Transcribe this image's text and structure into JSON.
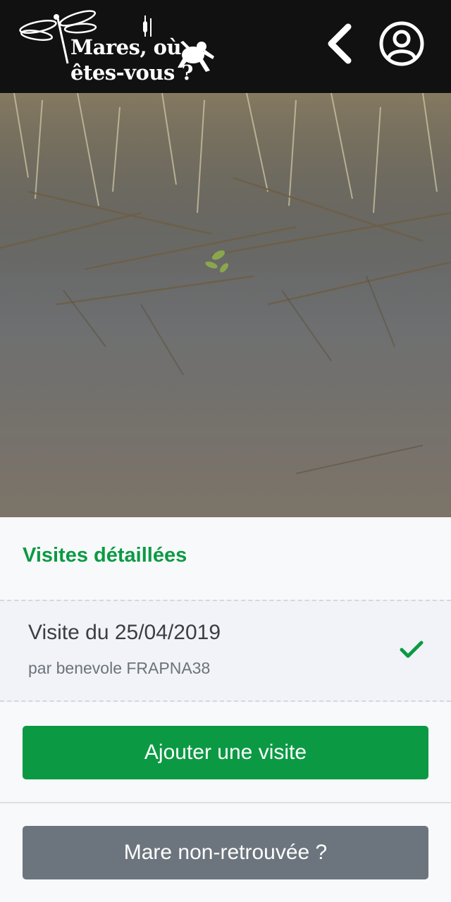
{
  "header": {
    "logo_line1": "Mares, où",
    "logo_line2": "êtes-vous ?",
    "logo_icons": [
      "dragonfly-icon",
      "cattail-icon",
      "frog-icon"
    ],
    "back_icon": "chevron-left-icon",
    "account_icon": "user-circle-icon",
    "background_color": "#111111"
  },
  "photo": {
    "subject": "pond-water-vegetation-photo"
  },
  "visits": {
    "title": "Visites détaillées",
    "accent_color": "#0b9a43",
    "items": [
      {
        "title": "Visite du 25/04/2019",
        "author": "par benevole FRAPNA38",
        "status_icon": "check-icon"
      }
    ]
  },
  "actions": {
    "add_visit_label": "Ajouter une visite",
    "add_visit_color": "#0b9a43",
    "not_found_label": "Mare non-retrouvée ?",
    "not_found_color": "#6c757d"
  }
}
